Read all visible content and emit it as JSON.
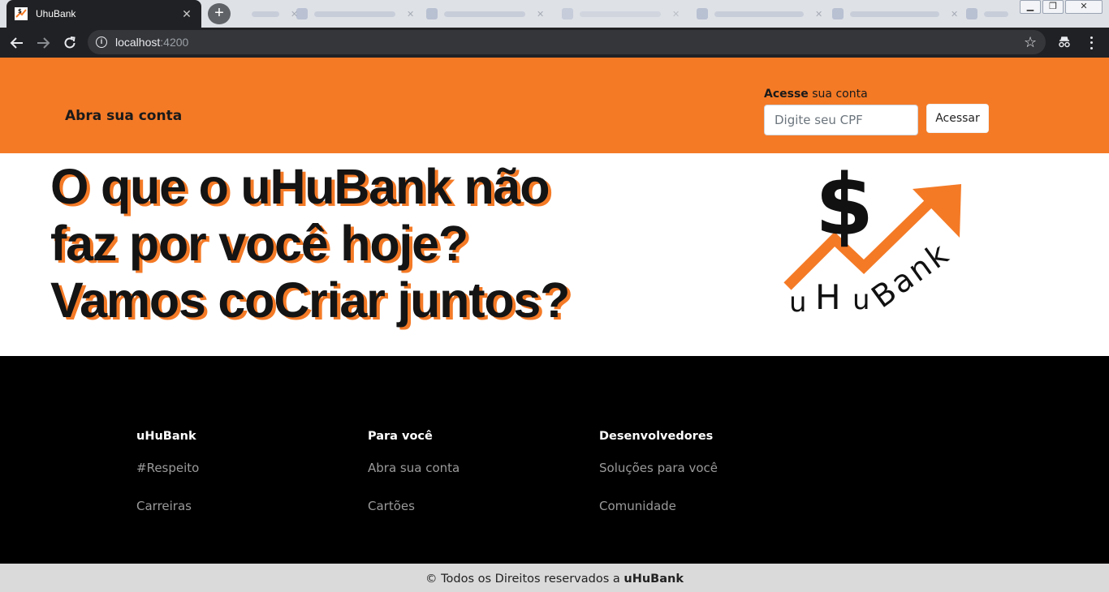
{
  "browser": {
    "tab_title": "UhuBank",
    "tab_close": "✕",
    "new_tab_symbol": "+",
    "url_host": "localhost",
    "url_port": ":4200",
    "minimize_symbol": "▁",
    "restore_symbol": "❐",
    "close_symbol": "✕"
  },
  "header": {
    "open_account_link": "Abra sua conta",
    "login_label_bold": "Acesse",
    "login_label_rest": " sua conta",
    "cpf_placeholder": "Digite seu CPF",
    "submit_label": "Acessar"
  },
  "hero": {
    "lines": [
      "O que o uHuBank não",
      "faz por você hoje?",
      "Vamos coCriar juntos?"
    ],
    "logo": {
      "symbol": "$",
      "text_u1": "u",
      "text_h": "H",
      "text_u2": "u",
      "text_bank": "Bank"
    }
  },
  "footer": {
    "columns": [
      {
        "title": "uHuBank",
        "links": [
          "#Respeito",
          "Carreiras"
        ]
      },
      {
        "title": "Para você",
        "links": [
          "Abra sua conta",
          "Cartões"
        ]
      },
      {
        "title": "Desenvolvedores",
        "links": [
          "Soluções para você",
          "Comunidade"
        ]
      }
    ],
    "copyright_prefix": "© Todos os Direitos reservados a ",
    "copyright_brand": "uHuBank"
  },
  "colors": {
    "brand_orange": "#f47a26",
    "text_dark": "#141414",
    "footer_bg": "#000000",
    "copyright_bg": "#dadada"
  }
}
